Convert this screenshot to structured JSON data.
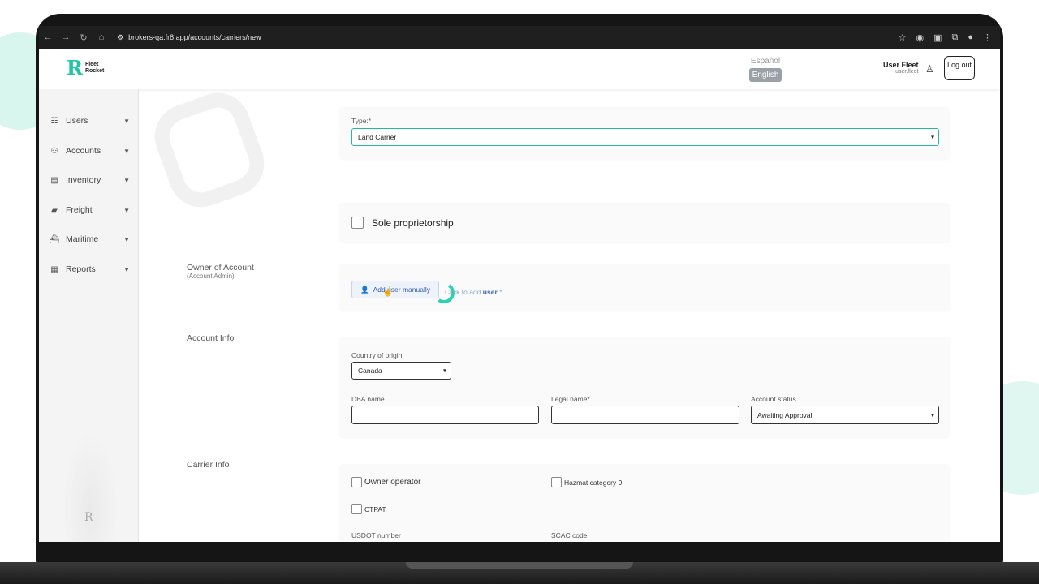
{
  "browser": {
    "url": "brokers-qa.fr8.app/accounts/carriers/new"
  },
  "header": {
    "logo_text_line1": "Fleet",
    "logo_text_line2": "Rocket",
    "lang_es": "Español",
    "lang_en": "English",
    "user_name": "User Fleet",
    "user_handle": "user.fleet",
    "logout_label": "Log out"
  },
  "sidebar": {
    "items": [
      {
        "label": "Users",
        "icon": "users-icon"
      },
      {
        "label": "Accounts",
        "icon": "accounts-icon"
      },
      {
        "label": "Inventory",
        "icon": "inventory-icon"
      },
      {
        "label": "Freight",
        "icon": "truck-icon"
      },
      {
        "label": "Maritime",
        "icon": "ship-icon"
      },
      {
        "label": "Reports",
        "icon": "reports-icon"
      }
    ]
  },
  "form": {
    "type_label": "Type:",
    "type_required": "*",
    "type_value": "Land Carrier",
    "sole_proprietorship_label": "Sole proprietorship",
    "owner_title": "Owner of Account",
    "owner_subtitle": "(Account Admin)",
    "add_user_button": "Add user manually",
    "click_hint_prefix": "Click to add",
    "click_hint_user": "user",
    "click_hint_required": "*",
    "account_info_title": "Account Info",
    "country_label": "Country of origin",
    "country_value": "Canada",
    "dba_label": "DBA name",
    "legal_label": "Legal name",
    "legal_required": "*",
    "status_label": "Account status",
    "status_value": "Awaiting Approval",
    "carrier_info_title": "Carrier Info",
    "owner_operator_label": "Owner operator",
    "hazmat_label": "Hazmat category 9",
    "ctpat_label": "CTPAT",
    "usdot_label": "USDOT number",
    "scac_label": "SCAC code"
  }
}
